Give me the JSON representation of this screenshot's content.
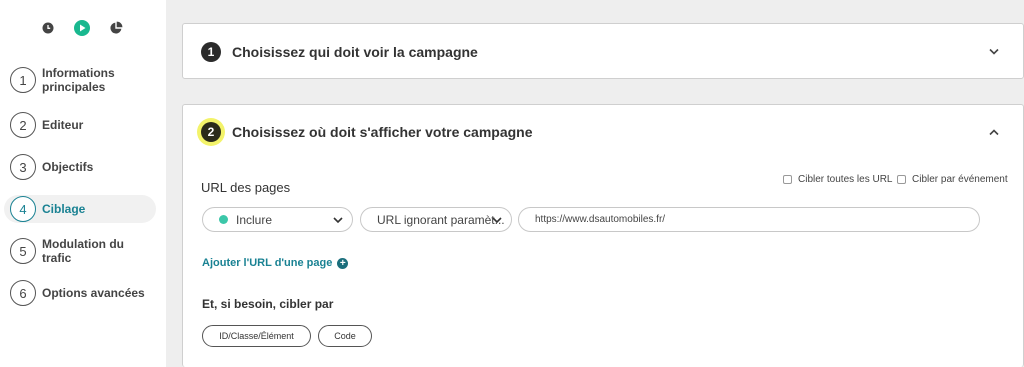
{
  "sidebar": {
    "top_icons": [
      "clock-icon",
      "play-icon",
      "pie-chart-icon"
    ],
    "steps": [
      {
        "num": "1",
        "label": "Informations principales",
        "active": false
      },
      {
        "num": "2",
        "label": "Editeur",
        "active": false
      },
      {
        "num": "3",
        "label": "Objectifs",
        "active": false
      },
      {
        "num": "4",
        "label": "Ciblage",
        "active": true
      },
      {
        "num": "5",
        "label": "Modulation du trafic",
        "active": false
      },
      {
        "num": "6",
        "label": "Options avancées",
        "active": false
      }
    ]
  },
  "section1": {
    "num": "1",
    "title": "Choisissez qui doit voir la campagne",
    "chevron": "chevron-down-icon"
  },
  "section2": {
    "num": "2",
    "title": "Choisissez où doit s'afficher votre campagne",
    "chevron": "chevron-up-icon",
    "url_label": "URL des pages",
    "check_all_urls": "Cibler toutes les URL",
    "check_event": "Cibler par événement",
    "include_select": "Inclure",
    "match_select": "URL ignorant paramèt...",
    "url_value": "https://www.dsautomobiles.fr/",
    "add_url": "Ajouter l'URL d'une page",
    "sub_label": "Et, si besoin, cibler par",
    "pill_id": "ID/Classe/Élément",
    "pill_code": "Code"
  },
  "colors": {
    "accent": "#1a8293",
    "include_dot": "#3cc7a9",
    "highlight": "#f3f36a"
  }
}
